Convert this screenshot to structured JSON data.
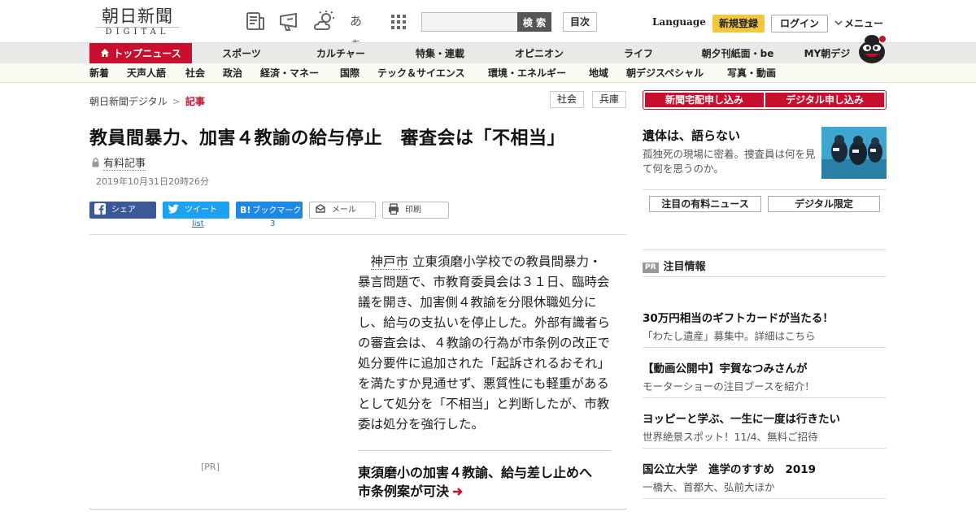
{
  "header": {
    "logo_jp": "朝日新聞",
    "logo_en": "DIGITAL",
    "icons": [
      "newspaper-icon",
      "megaphone-icon",
      "weather-icon",
      "font-size-icon",
      "grid-icon"
    ],
    "font_size_glyph": "あぁ",
    "search_placeholder": "",
    "search_label": "検 索",
    "toc_label": "目次",
    "language_label": "Language",
    "register_label": "新規登録",
    "login_label": "ログイン",
    "menu_label": "メニュー"
  },
  "nav_primary": [
    {
      "label": "トップニュース",
      "active": true
    },
    {
      "label": "スポーツ"
    },
    {
      "label": "カルチャー"
    },
    {
      "label": "特集・連載"
    },
    {
      "label": "オピニオン"
    },
    {
      "label": "ライフ"
    },
    {
      "label": "朝夕刊紙面・be"
    },
    {
      "label": "MY朝デジ"
    }
  ],
  "nav_secondary": [
    "新着",
    "天声人語",
    "社会",
    "政治",
    "経済・マネー",
    "国際",
    "テック＆サイエンス",
    "環境・エネルギー",
    "地域",
    "朝デジスペシャル",
    "写真・動画"
  ],
  "breadcrumb": {
    "home": "朝日新聞デジタル",
    "separator": ">",
    "current": "記事"
  },
  "tags": [
    "社会",
    "兵庫"
  ],
  "article": {
    "headline": "教員間暴力、加害４教諭の給与停止　審査会は「不相当」",
    "paid_label": "有料記事",
    "date": "2019年10月31日20時26分",
    "share": {
      "facebook": "シェア",
      "twitter": "ツイート",
      "twitter_count": "list",
      "hatena": "ブックマーク",
      "hatena_count": "3",
      "mail": "メール",
      "print": "印刷"
    },
    "pr_label": "[PR]",
    "body_keyword": "神戸市",
    "body_rest": "立東須磨小学校での教員間暴力・暴言問題で、市教育委員会は３１日、臨時会議を開き、加害側４教諭を分限休職処分にし、給与の支払いを停止した。外部有識者らの審査会は、４教諭の行為が市条例の改正で処分要件に追加された「起訴されるおそれ」を満たすか見通せず、悪質性にも軽重があるとして処分を「不相当」と判断したが、市教委は処分を強行した。",
    "related": "東須磨小の加害４教諭、給与差し止めへ　市条例案が可決"
  },
  "sidebar": {
    "subscribe_delivery": "新聞宅配申し込み",
    "subscribe_digital": "デジタル申し込み",
    "feature_title": "遺体は、語らない",
    "feature_desc": "孤独死の現場に密着。捜査員は何を見て何を思うのか。",
    "btn_paid_news": "注目の有料ニュース",
    "btn_digital_only": "デジタル限定",
    "pr_badge": "PR",
    "pr_heading": "注目情報",
    "pr_items": [
      {
        "title": "30万円相当のギフトカードが当たる！",
        "sub": "「わたし遺産」募集中。詳細はこちら"
      },
      {
        "title": "【動画公開中】宇賀なつみさんが",
        "sub": "モーターショーの注目ブースを紹介！"
      },
      {
        "title": "ヨッピーと学ぶ、一生に一度は行きたい",
        "sub": "世界絶景スポット！11/4、無料ご招待"
      },
      {
        "title": "国公立大学　進学のすすめ　2019",
        "sub": "一橋大、首都大、弘前大ほか"
      }
    ]
  },
  "colors": {
    "brand_red": "#c8102e",
    "register_yellow": "#f3c640",
    "facebook": "#3b5998",
    "twitter": "#1da1f2",
    "hatena": "#1e88e5"
  }
}
